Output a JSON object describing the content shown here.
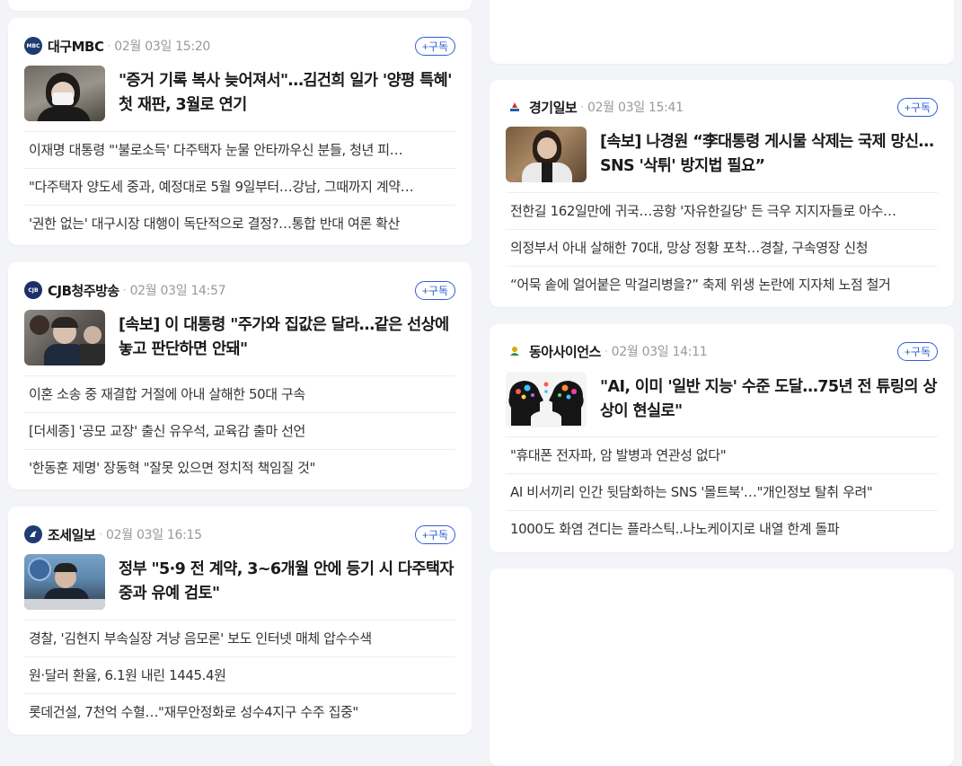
{
  "cards": [
    {
      "press": "대구MBC",
      "time": "02월 03일 15:20",
      "subscribe": "+구독",
      "main_title": "\"증거 기록 복사 늦어져서\"…김건희 일가 '양평 특혜' 첫 재판, 3월로 연기",
      "items": [
        "이재명 대통령 \"'불로소득' 다주택자 눈물 안타까우신 분들, 청년 피…",
        "\"다주택자 양도세 중과, 예정대로 5월 9일부터…강남, 그때까지 계약…",
        "'권한 없는' 대구시장 대행이 독단적으로 결정?…통합 반대 여론 확산"
      ]
    },
    {
      "press": "CJB청주방송",
      "time": "02월 03일 14:57",
      "subscribe": "+구독",
      "main_title": "[속보] 이 대통령 \"주가와 집값은 달라…같은 선상에 놓고 판단하면 안돼\"",
      "items": [
        "이혼 소송 중 재결합 거절에 아내 살해한 50대 구속",
        "[더세종] '공모 교장' 출신 유우석, 교육감 출마 선언",
        "'한동훈 제명' 장동혁 \"잘못 있으면 정치적 책임질 것\""
      ]
    },
    {
      "press": "조세일보",
      "time": "02월 03일 16:15",
      "subscribe": "+구독",
      "main_title": "정부 \"5·9 전 계약, 3~6개월 안에 등기 시 다주택자 중과 유예 검토\"",
      "items": [
        "경찰, '김현지 부속실장 겨냥 음모론' 보도 인터넷 매체 압수수색",
        "원·달러 환율, 6.1원 내린 1445.4원",
        "롯데건설, 7천억 수혈…\"재무안정화로 성수4지구 수주 집중\""
      ]
    },
    {
      "press": "경기일보",
      "time": "02월 03일 15:41",
      "subscribe": "+구독",
      "main_title": "[속보] 나경원 “李대통령 게시물 삭제는 국제 망신…SNS '삭튀' 방지법 필요”",
      "items": [
        "전한길 162일만에 귀국…공항 '자유한길당' 든 극우 지지자들로 아수…",
        "의정부서 아내 살해한 70대, 망상 정황 포착…경찰, 구속영장 신청",
        "“어묵 솥에 얼어붙은 막걸리병을?” 축제 위생 논란에 지자체 노점 철거"
      ]
    },
    {
      "press": "동아사이언스",
      "time": "02월 03일 14:11",
      "subscribe": "+구독",
      "main_title": "\"AI, 이미 '일반 지능' 수준 도달…75년 전 튜링의 상상이 현실로\"",
      "items": [
        "\"휴대폰 전자파, 암 발병과 연관성 없다\"",
        "AI 비서끼리 인간 뒷담화하는 SNS '몰트북'…\"개인정보 탈취 우려\"",
        "1000도 화염 견디는 플라스틱..나노케이지로 내열 한계 돌파"
      ]
    }
  ]
}
